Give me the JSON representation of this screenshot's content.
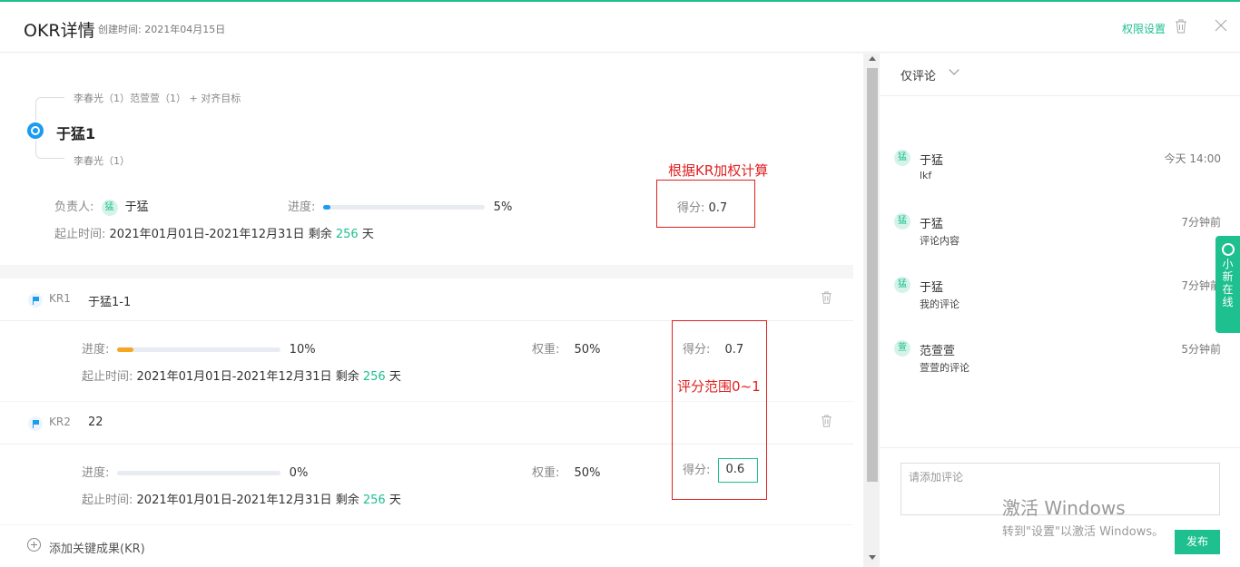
{
  "header": {
    "title": "OKR详情",
    "created_label": "创建时间:",
    "created_date": "2021年04月15日",
    "permission_label": "权限设置"
  },
  "objective": {
    "parents": "李春光（1）范萱萱（1）",
    "align_label": "+ 对齐目标",
    "title": "于猛1",
    "child": "李春光（1）",
    "owner_label": "负责人:",
    "owner_avatar": "猛",
    "owner_name": "于猛",
    "progress_label": "进度:",
    "progress_value": "5%",
    "progress_fraction": 0.05,
    "time_label": "起止时间:",
    "time_range": "2021年01月01日-2021年12月31日",
    "remain_label": "剩余",
    "remain_days": "256",
    "days_unit": "天",
    "score_label": "得分:",
    "score_value": "0.7"
  },
  "annotations": {
    "weighted_note": "根据KR加权计算",
    "range_note": "评分范围0~1"
  },
  "key_results": [
    {
      "code": "KR1",
      "name": "于猛1-1",
      "progress_label": "进度:",
      "progress_value": "10%",
      "progress_fraction": 0.1,
      "progress_color": "#f5a623",
      "weight_label": "权重:",
      "weight_value": "50%",
      "score_label": "得分:",
      "score_value": "0.7",
      "time_label": "起止时间:",
      "time_range": "2021年01月01日-2021年12月31日",
      "remain_label": "剩余",
      "remain_days": "256",
      "days_unit": "天"
    },
    {
      "code": "KR2",
      "name": "22",
      "progress_label": "进度:",
      "progress_value": "0%",
      "progress_fraction": 0,
      "progress_color": "#1a9cf0",
      "weight_label": "权重:",
      "weight_value": "50%",
      "score_label": "得分:",
      "score_value": "0.6",
      "time_label": "起止时间:",
      "time_range": "2021年01月01日-2021年12月31日",
      "remain_label": "剩余",
      "remain_days": "256",
      "days_unit": "天"
    }
  ],
  "add_kr_label": "添加关键成果(KR)",
  "comments_panel": {
    "filter_label": "仅评论",
    "comments": [
      {
        "avatar": "猛",
        "name": "于猛",
        "time": "今天 14:00",
        "body": "lkf"
      },
      {
        "avatar": "猛",
        "name": "于猛",
        "time": "7分钟前",
        "body": "评论内容"
      },
      {
        "avatar": "猛",
        "name": "于猛",
        "time": "7分钟前",
        "body": "我的评论"
      },
      {
        "avatar": "萱",
        "name": "范萱萱",
        "time": "5分钟前",
        "body": "萱萱的评论"
      }
    ],
    "input_placeholder": "请添加评论",
    "publish_label": "发布"
  },
  "side_tab_label": "小新在线",
  "watermark": {
    "line1": "激活 Windows",
    "line2": "转到\"设置\"以激活 Windows。"
  },
  "colors": {
    "accent": "#1ec08f",
    "blue": "#1a9cf0",
    "annotation": "#e02020"
  }
}
